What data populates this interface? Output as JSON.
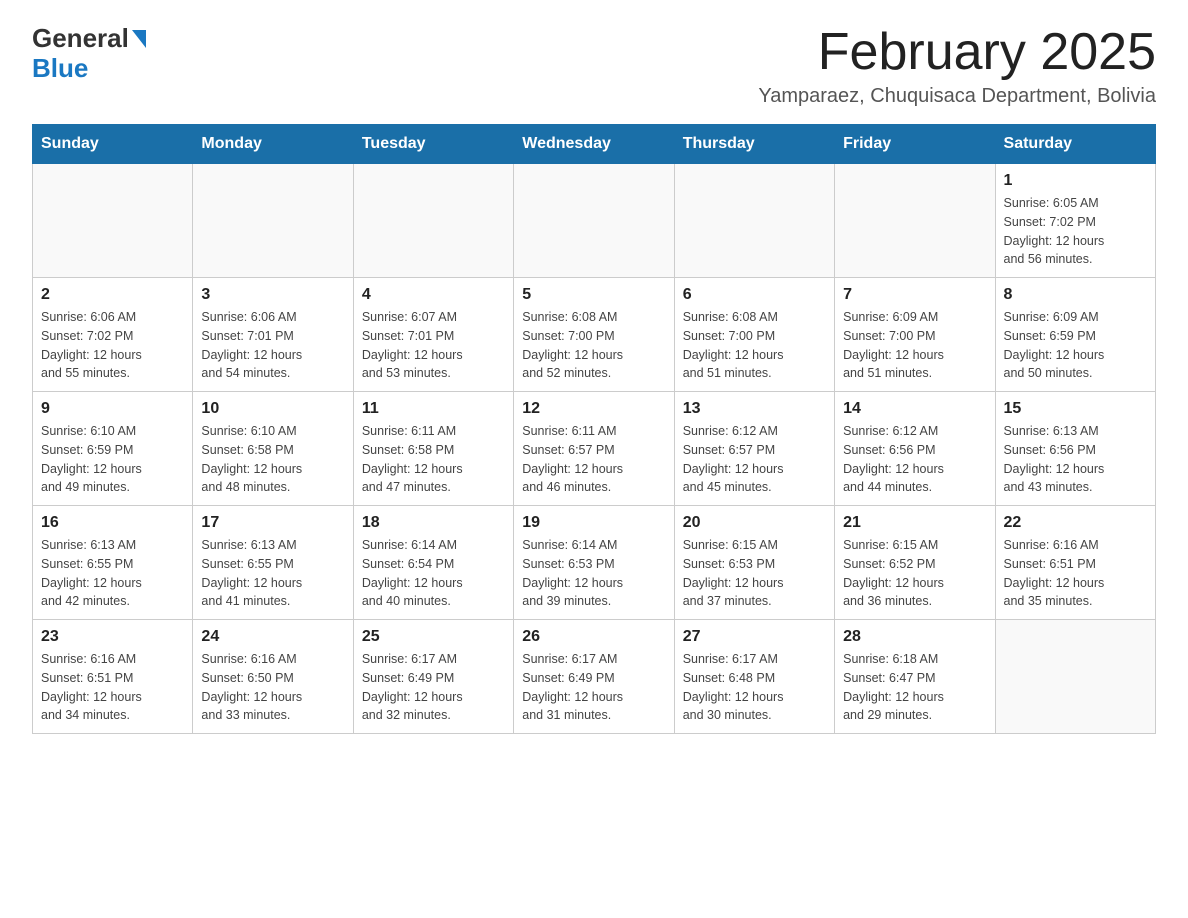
{
  "header": {
    "logo_text_general": "General",
    "logo_text_blue": "Blue",
    "main_title": "February 2025",
    "subtitle": "Yamparaez, Chuquisaca Department, Bolivia"
  },
  "calendar": {
    "days_of_week": [
      "Sunday",
      "Monday",
      "Tuesday",
      "Wednesday",
      "Thursday",
      "Friday",
      "Saturday"
    ],
    "weeks": [
      [
        {
          "day": "",
          "info": ""
        },
        {
          "day": "",
          "info": ""
        },
        {
          "day": "",
          "info": ""
        },
        {
          "day": "",
          "info": ""
        },
        {
          "day": "",
          "info": ""
        },
        {
          "day": "",
          "info": ""
        },
        {
          "day": "1",
          "info": "Sunrise: 6:05 AM\nSunset: 7:02 PM\nDaylight: 12 hours\nand 56 minutes."
        }
      ],
      [
        {
          "day": "2",
          "info": "Sunrise: 6:06 AM\nSunset: 7:02 PM\nDaylight: 12 hours\nand 55 minutes."
        },
        {
          "day": "3",
          "info": "Sunrise: 6:06 AM\nSunset: 7:01 PM\nDaylight: 12 hours\nand 54 minutes."
        },
        {
          "day": "4",
          "info": "Sunrise: 6:07 AM\nSunset: 7:01 PM\nDaylight: 12 hours\nand 53 minutes."
        },
        {
          "day": "5",
          "info": "Sunrise: 6:08 AM\nSunset: 7:00 PM\nDaylight: 12 hours\nand 52 minutes."
        },
        {
          "day": "6",
          "info": "Sunrise: 6:08 AM\nSunset: 7:00 PM\nDaylight: 12 hours\nand 51 minutes."
        },
        {
          "day": "7",
          "info": "Sunrise: 6:09 AM\nSunset: 7:00 PM\nDaylight: 12 hours\nand 51 minutes."
        },
        {
          "day": "8",
          "info": "Sunrise: 6:09 AM\nSunset: 6:59 PM\nDaylight: 12 hours\nand 50 minutes."
        }
      ],
      [
        {
          "day": "9",
          "info": "Sunrise: 6:10 AM\nSunset: 6:59 PM\nDaylight: 12 hours\nand 49 minutes."
        },
        {
          "day": "10",
          "info": "Sunrise: 6:10 AM\nSunset: 6:58 PM\nDaylight: 12 hours\nand 48 minutes."
        },
        {
          "day": "11",
          "info": "Sunrise: 6:11 AM\nSunset: 6:58 PM\nDaylight: 12 hours\nand 47 minutes."
        },
        {
          "day": "12",
          "info": "Sunrise: 6:11 AM\nSunset: 6:57 PM\nDaylight: 12 hours\nand 46 minutes."
        },
        {
          "day": "13",
          "info": "Sunrise: 6:12 AM\nSunset: 6:57 PM\nDaylight: 12 hours\nand 45 minutes."
        },
        {
          "day": "14",
          "info": "Sunrise: 6:12 AM\nSunset: 6:56 PM\nDaylight: 12 hours\nand 44 minutes."
        },
        {
          "day": "15",
          "info": "Sunrise: 6:13 AM\nSunset: 6:56 PM\nDaylight: 12 hours\nand 43 minutes."
        }
      ],
      [
        {
          "day": "16",
          "info": "Sunrise: 6:13 AM\nSunset: 6:55 PM\nDaylight: 12 hours\nand 42 minutes."
        },
        {
          "day": "17",
          "info": "Sunrise: 6:13 AM\nSunset: 6:55 PM\nDaylight: 12 hours\nand 41 minutes."
        },
        {
          "day": "18",
          "info": "Sunrise: 6:14 AM\nSunset: 6:54 PM\nDaylight: 12 hours\nand 40 minutes."
        },
        {
          "day": "19",
          "info": "Sunrise: 6:14 AM\nSunset: 6:53 PM\nDaylight: 12 hours\nand 39 minutes."
        },
        {
          "day": "20",
          "info": "Sunrise: 6:15 AM\nSunset: 6:53 PM\nDaylight: 12 hours\nand 37 minutes."
        },
        {
          "day": "21",
          "info": "Sunrise: 6:15 AM\nSunset: 6:52 PM\nDaylight: 12 hours\nand 36 minutes."
        },
        {
          "day": "22",
          "info": "Sunrise: 6:16 AM\nSunset: 6:51 PM\nDaylight: 12 hours\nand 35 minutes."
        }
      ],
      [
        {
          "day": "23",
          "info": "Sunrise: 6:16 AM\nSunset: 6:51 PM\nDaylight: 12 hours\nand 34 minutes."
        },
        {
          "day": "24",
          "info": "Sunrise: 6:16 AM\nSunset: 6:50 PM\nDaylight: 12 hours\nand 33 minutes."
        },
        {
          "day": "25",
          "info": "Sunrise: 6:17 AM\nSunset: 6:49 PM\nDaylight: 12 hours\nand 32 minutes."
        },
        {
          "day": "26",
          "info": "Sunrise: 6:17 AM\nSunset: 6:49 PM\nDaylight: 12 hours\nand 31 minutes."
        },
        {
          "day": "27",
          "info": "Sunrise: 6:17 AM\nSunset: 6:48 PM\nDaylight: 12 hours\nand 30 minutes."
        },
        {
          "day": "28",
          "info": "Sunrise: 6:18 AM\nSunset: 6:47 PM\nDaylight: 12 hours\nand 29 minutes."
        },
        {
          "day": "",
          "info": ""
        }
      ]
    ]
  }
}
